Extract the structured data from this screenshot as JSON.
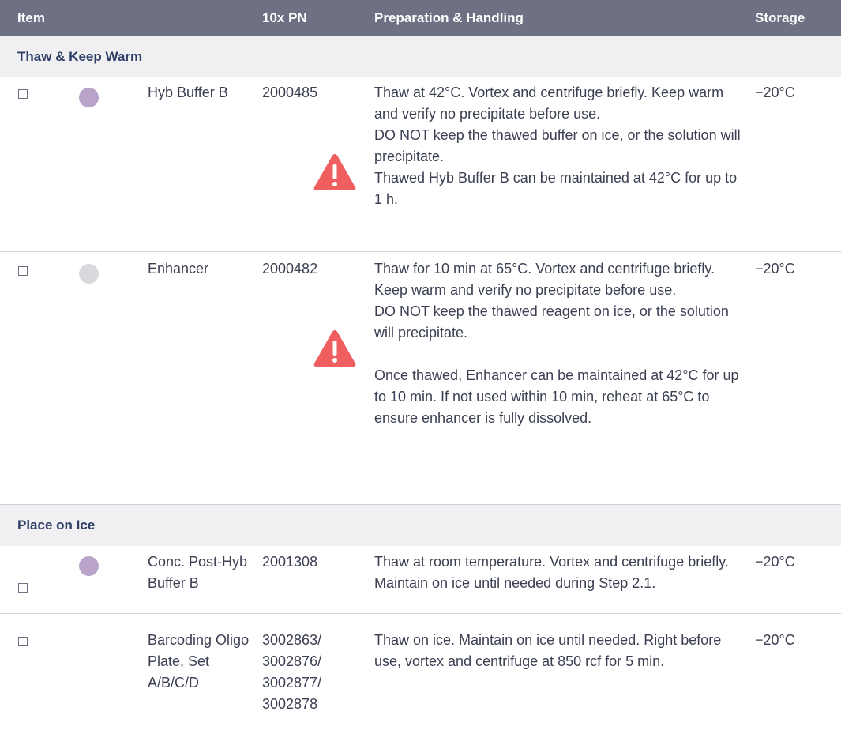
{
  "header": {
    "item": "Item",
    "pn": "10x PN",
    "prep": "Preparation & Handling",
    "storage": "Storage"
  },
  "sections": {
    "warm": "Thaw & Keep Warm",
    "ice": "Place on Ice"
  },
  "rows": [
    {
      "checkbox": "□",
      "dot_color": "#b9a3c9",
      "item": "Hyb Buffer B",
      "pn": "2000485",
      "prep": [
        "Thaw at 42°C. Vortex and centrifuge briefly. Keep warm and verify no precipitate before use.",
        "DO NOT keep the thawed buffer on ice, or the solution will precipitate.",
        "Thawed Hyb Buffer B can be maintained at 42°C for up to 1 h."
      ],
      "storage": "−20°C",
      "warning_icon": "warning-icon"
    },
    {
      "checkbox": "□",
      "dot_color": "#d9d9dd",
      "item": "Enhancer",
      "pn": "2000482",
      "prep": [
        "Thaw for 10 min at 65°C. Vortex and centrifuge briefly. Keep warm and verify no precipitate before use.",
        "DO NOT keep the thawed reagent on ice, or the solution will precipitate.",
        "Once thawed, Enhancer can be maintained at 42°C for up to 10 min. If not used within 10 min, reheat at 65°C to ensure enhancer is fully dissolved."
      ],
      "storage": "−20°C",
      "warning_icon": "warning-icon"
    },
    {
      "checkbox": "□",
      "dot_color": "#b9a3c9",
      "item": "Conc. Post-Hyb Buffer B",
      "pn": "2001308",
      "prep": [
        "Thaw at room temperature. Vortex and centrifuge briefly. Maintain on ice until needed during Step 2.1."
      ],
      "storage": "−20°C"
    },
    {
      "checkbox": "□",
      "item": "Barcoding Oligo Plate, Set A/B/C/D",
      "pn": "3002863/ 3002876/ 3002877/ 3002878",
      "prep": [
        "Thaw on ice. Maintain on ice until needed. Right before use, vortex and centrifuge at 850 rcf for 5 min."
      ],
      "storage": "−20°C"
    }
  ],
  "colors": {
    "header_bg": "#6e7183",
    "section_bg": "#f0f0f3",
    "section_text": "#2f3e66",
    "warning": "#ef5f5f"
  }
}
